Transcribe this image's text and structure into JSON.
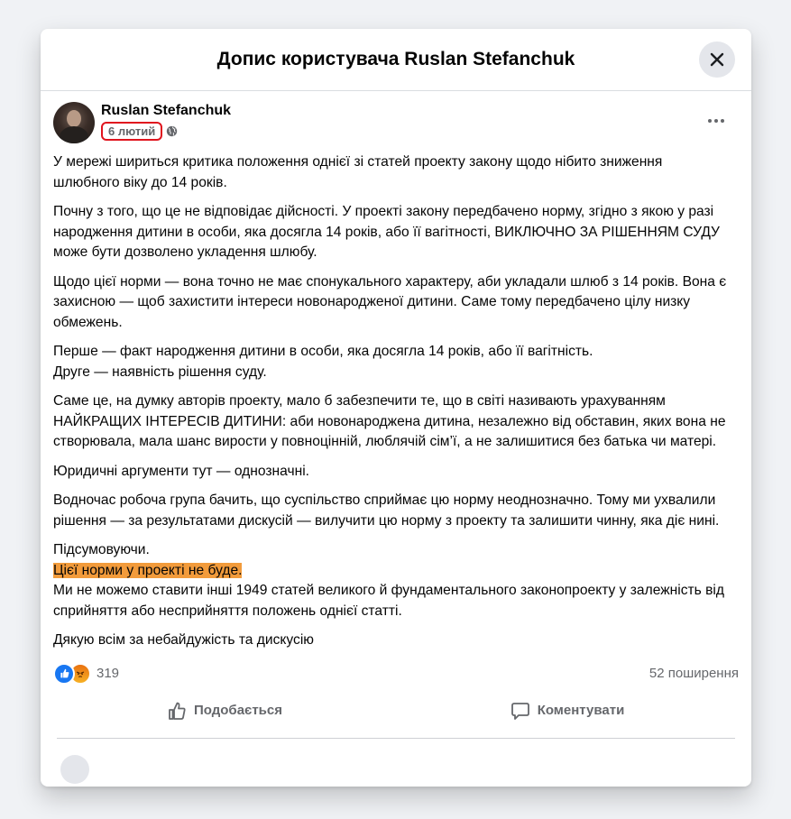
{
  "dialog": {
    "title": "Допис користувача Ruslan Stefanchuk",
    "close_icon": "close-icon"
  },
  "post": {
    "author": "Ruslan Stefanchuk",
    "date": "6 лютий",
    "audience_icon": "globe-icon",
    "more_icon": "more-options-icon",
    "paragraphs": {
      "p1": "У мережі шириться критика положення однієї зі статей проекту закону щодо нібито зниження шлюбного віку до 14 років.",
      "p2": "Почну з того, що це не відповідає дійсності. У проекті закону передбачено норму, згідно з якою у разі народження дитини в особи, яка досягла 14 років, або її вагітності, ВИКЛЮЧНО ЗА РІШЕННЯМ СУДУ може бути дозволено укладення шлюбу.",
      "p3": "Щодо цієї норми — вона точно не має спонукального характеру, аби укладали шлюб з 14 років. Вона є захисною — щоб захистити інтереси новонародженої дитини. Саме тому передбачено цілу низку обмежень.",
      "p4a": "Перше — факт народження дитини в особи, яка досягла 14 років, або її вагітність.",
      "p4b": "Друге — наявність рішення суду.",
      "p5": "Саме це, на думку авторів проекту, мало б забезпечити те, що в світі називають урахуванням НАЙКРАЩИХ ІНТЕРЕСІВ ДИТИНИ: аби новонароджена дитина, незалежно від обставин, яких вона не створювала, мала шанс вирости у повноцінній, люблячій сім’ї, а не залишитися без батька чи матері.",
      "p6": "Юридичні аргументи тут — однозначні.",
      "p7": "Водночас робоча група бачить, що суспільство сприймає цю норму неоднозначно. Тому ми ухвалили рішення — за результатами дискусій — вилучити цю норму з проекту та залишити чинну, яка діє нині.",
      "p8a": "Підсумовуючи.",
      "p8b": "Цієї норми у проекті не буде.",
      "p8c": "Ми не можемо ставити інші 1949 статей великого й фундаментального законопроекту у залежність від сприйняття або несприйняття положень однієї статті.",
      "p9": "Дякую всім за небайдужість та дискусію"
    },
    "highlight_color": "#f29b3b",
    "date_outline_color": "#e0141e"
  },
  "stats": {
    "reaction_icons": [
      "like-reaction-icon",
      "angry-reaction-icon"
    ],
    "reaction_count": "319",
    "shares": "52 поширення"
  },
  "actions": {
    "like_label": "Подобається",
    "like_icon": "thumbs-up-icon",
    "comment_label": "Коментувати",
    "comment_icon": "comment-icon"
  }
}
